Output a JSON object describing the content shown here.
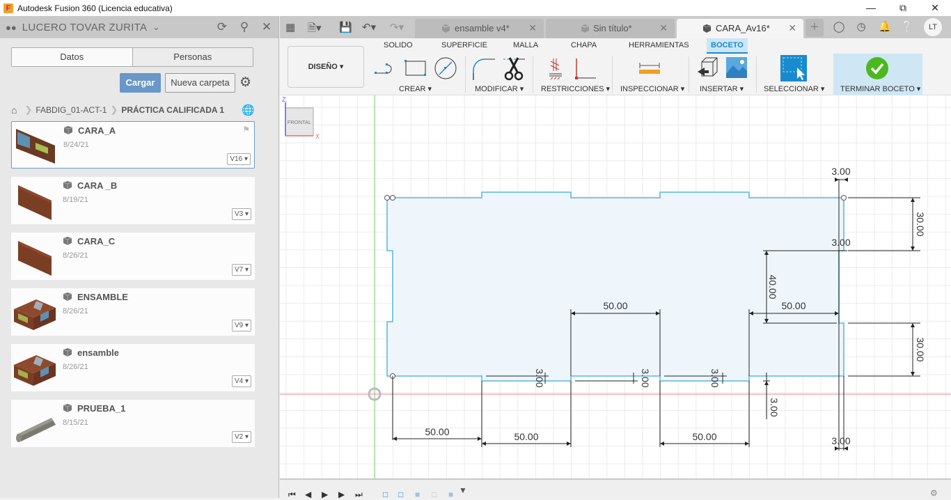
{
  "window": {
    "title": "Autodesk Fusion 360 (Licencia educativa)",
    "app_icon": "fusion-icon",
    "controls": [
      "minimize",
      "maximize",
      "close"
    ]
  },
  "data_panel": {
    "user": "LUCERO TOVAR ZURITA",
    "header_icons": [
      "refresh-icon",
      "search-icon",
      "close-icon"
    ],
    "tabs": [
      {
        "label": "Datos",
        "active": true
      },
      {
        "label": "Personas",
        "active": false
      }
    ],
    "upload_label": "Cargar",
    "new_folder_label": "Nueva carpeta",
    "breadcrumb": {
      "items": [
        "FABDIG_01-ACT-1",
        "PRÁCTICA CALIFICADA 1"
      ]
    },
    "files": [
      {
        "name": "CARA_A",
        "date": "8/24/21",
        "version": "V16",
        "selected": true,
        "flag": true,
        "thumb": "panel-butterfly"
      },
      {
        "name": "CARA _B",
        "date": "8/19/21",
        "version": "V3",
        "selected": false,
        "flag": false,
        "thumb": "panel-wood"
      },
      {
        "name": "CARA_C",
        "date": "8/26/21",
        "version": "V7",
        "selected": false,
        "flag": false,
        "thumb": "panel-wood"
      },
      {
        "name": "ENSAMBLE",
        "date": "8/26/21",
        "version": "V9",
        "selected": false,
        "flag": false,
        "thumb": "box"
      },
      {
        "name": "ensamble",
        "date": "8/26/21",
        "version": "V4",
        "selected": false,
        "flag": false,
        "thumb": "box"
      },
      {
        "name": "PRUEBA_1",
        "date": "8/15/21",
        "version": "V2",
        "selected": false,
        "flag": false,
        "thumb": "cylinder"
      }
    ]
  },
  "doc_tabs": [
    {
      "label": "ensamble v4*",
      "active": false
    },
    {
      "label": "Sin título*",
      "active": false
    },
    {
      "label": "CARA_Av16*",
      "active": true
    }
  ],
  "user_initials": "LT",
  "ribbon": {
    "workspace": "DISEÑO",
    "tabs": [
      {
        "label": "SOLIDO",
        "active": false
      },
      {
        "label": "SUPERFICIE",
        "active": false
      },
      {
        "label": "MALLA",
        "active": false
      },
      {
        "label": "CHAPA",
        "active": false
      },
      {
        "label": "HERRAMIENTAS",
        "active": false
      },
      {
        "label": "BOCETO",
        "active": true
      }
    ],
    "groups": [
      {
        "label": "CREAR ▾"
      },
      {
        "label": "MODIFICAR ▾"
      },
      {
        "label": "RESTRICCIONES ▾"
      },
      {
        "label": "INSPECCIONAR ▾"
      },
      {
        "label": "INSERTAR ▾"
      },
      {
        "label": "SELECCIONAR ▾"
      },
      {
        "label": "TERMINAR BOCETO ▾"
      }
    ]
  },
  "viewcube": {
    "face": "FRONTAL",
    "axis_z": "Z",
    "axis_x": "X"
  },
  "sketch": {
    "dimensions": {
      "top_notch": "3.00",
      "right_notch": "3.00",
      "right_upper": "30.00",
      "right_lower": "30.00",
      "mid_height": "40.00",
      "upper_right_width": "50.00",
      "mid_width": "50.00",
      "bottom_widths": [
        "50.00",
        "50.00",
        "50.00"
      ],
      "bottom_notches": [
        "3.00",
        "3.00",
        "3.00",
        "3.00"
      ],
      "bottom_right_notch": "3.00"
    }
  },
  "timeline": {
    "controls": [
      "first",
      "previous",
      "play",
      "next",
      "last"
    ]
  }
}
